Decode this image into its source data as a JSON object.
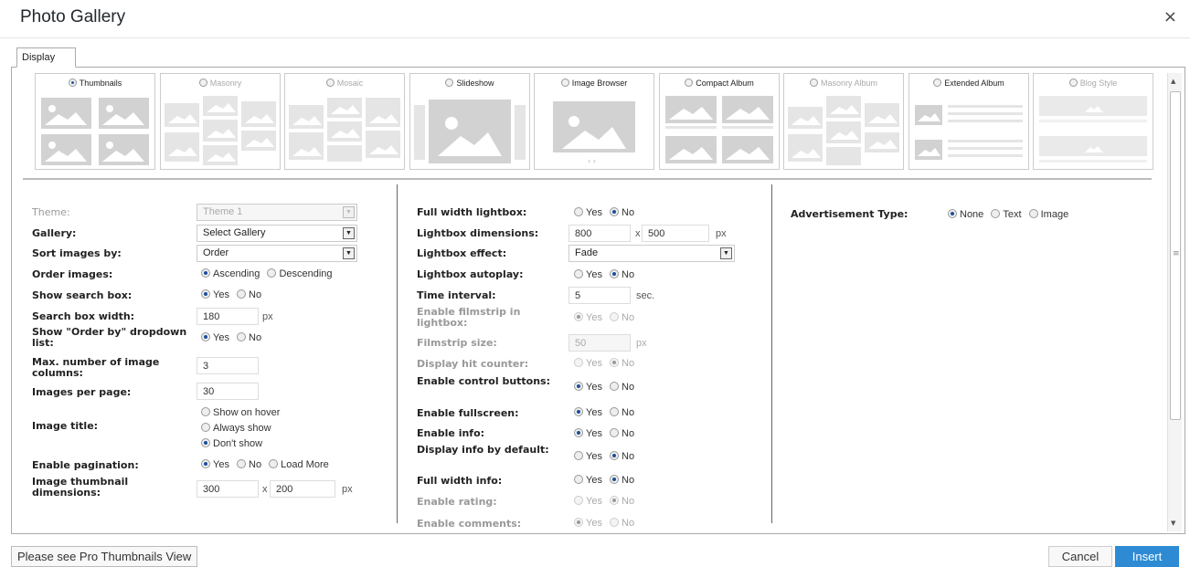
{
  "dialog": {
    "title": "Photo Gallery",
    "close_symbol": "×"
  },
  "tabs": [
    {
      "label": "Display"
    }
  ],
  "views": [
    {
      "label": "Thumbnails",
      "selected": true
    },
    {
      "label": "Masonry",
      "selected": false
    },
    {
      "label": "Mosaic",
      "selected": false
    },
    {
      "label": "Slideshow",
      "selected": false
    },
    {
      "label": "Image Browser",
      "selected": false
    },
    {
      "label": "Compact Album",
      "selected": false
    },
    {
      "label": "Masonry Album",
      "selected": false
    },
    {
      "label": "Extended Album",
      "selected": false
    },
    {
      "label": "Blog Style",
      "selected": false
    }
  ],
  "col1": {
    "theme": {
      "label": "Theme:",
      "value": "Theme 1"
    },
    "gallery": {
      "label": "Gallery:",
      "value": "Select Gallery"
    },
    "sort": {
      "label": "Sort images by:",
      "value": "Order"
    },
    "order": {
      "label": "Order images:",
      "options": [
        "Ascending",
        "Descending"
      ]
    },
    "show_search": {
      "label": "Show search box:",
      "options": [
        "Yes",
        "No"
      ]
    },
    "search_width": {
      "label": "Search box width:",
      "value": "180",
      "unit": "px"
    },
    "order_by": {
      "label": "Show \"Order by\" dropdown list:",
      "options": [
        "Yes",
        "No"
      ]
    },
    "max_cols": {
      "label": "Max. number of image columns:",
      "value": "3"
    },
    "per_page": {
      "label": "Images per page:",
      "value": "30"
    },
    "image_title": {
      "label": "Image title:",
      "options": [
        "Show on hover",
        "Always show",
        "Don't show"
      ]
    },
    "pagination": {
      "label": "Enable pagination:",
      "options": [
        "Yes",
        "No",
        "Load More"
      ]
    },
    "thumb_dims": {
      "label": "Image thumbnail dimensions:",
      "width": "300",
      "height": "200",
      "times": "x",
      "unit": "px"
    }
  },
  "col2": {
    "full_width_lightbox": {
      "label": "Full width lightbox:",
      "options": [
        "Yes",
        "No"
      ]
    },
    "lightbox_dims": {
      "label": "Lightbox dimensions:",
      "width": "800",
      "height": "500",
      "times": "x",
      "unit": "px"
    },
    "lightbox_effect": {
      "label": "Lightbox effect:",
      "value": "Fade"
    },
    "lightbox_autoplay": {
      "label": "Lightbox autoplay:",
      "options": [
        "Yes",
        "No"
      ]
    },
    "time_interval": {
      "label": "Time interval:",
      "value": "5",
      "unit": "sec."
    },
    "filmstrip": {
      "label": "Enable filmstrip in lightbox:",
      "options": [
        "Yes",
        "No"
      ]
    },
    "filmstrip_size": {
      "label": "Filmstrip size:",
      "value": "50",
      "unit": "px"
    },
    "hit_counter": {
      "label": "Display hit counter:",
      "options": [
        "Yes",
        "No"
      ]
    },
    "control_buttons": {
      "label": "Enable control buttons:",
      "options": [
        "Yes",
        "No"
      ]
    },
    "fullscreen": {
      "label": "Enable fullscreen:",
      "options": [
        "Yes",
        "No"
      ]
    },
    "info": {
      "label": "Enable info:",
      "options": [
        "Yes",
        "No"
      ]
    },
    "info_default": {
      "label": "Display info by default:",
      "options": [
        "Yes",
        "No"
      ]
    },
    "full_width_info": {
      "label": "Full width info:",
      "options": [
        "Yes",
        "No"
      ]
    },
    "rating": {
      "label": "Enable rating:",
      "options": [
        "Yes",
        "No"
      ]
    },
    "comments": {
      "label": "Enable comments:",
      "options": [
        "Yes",
        "No"
      ]
    }
  },
  "col3": {
    "ad_type": {
      "label": "Advertisement Type:",
      "options": [
        "None",
        "Text",
        "Image"
      ]
    }
  },
  "footer": {
    "pro_label": "Please see Pro Thumbnails View",
    "cancel_label": "Cancel",
    "insert_label": "Insert"
  },
  "colors": {
    "accent": "#2e8bd3",
    "radio_checked": "#1c4f9c",
    "placeholder_grey": "#cfcfcf"
  }
}
